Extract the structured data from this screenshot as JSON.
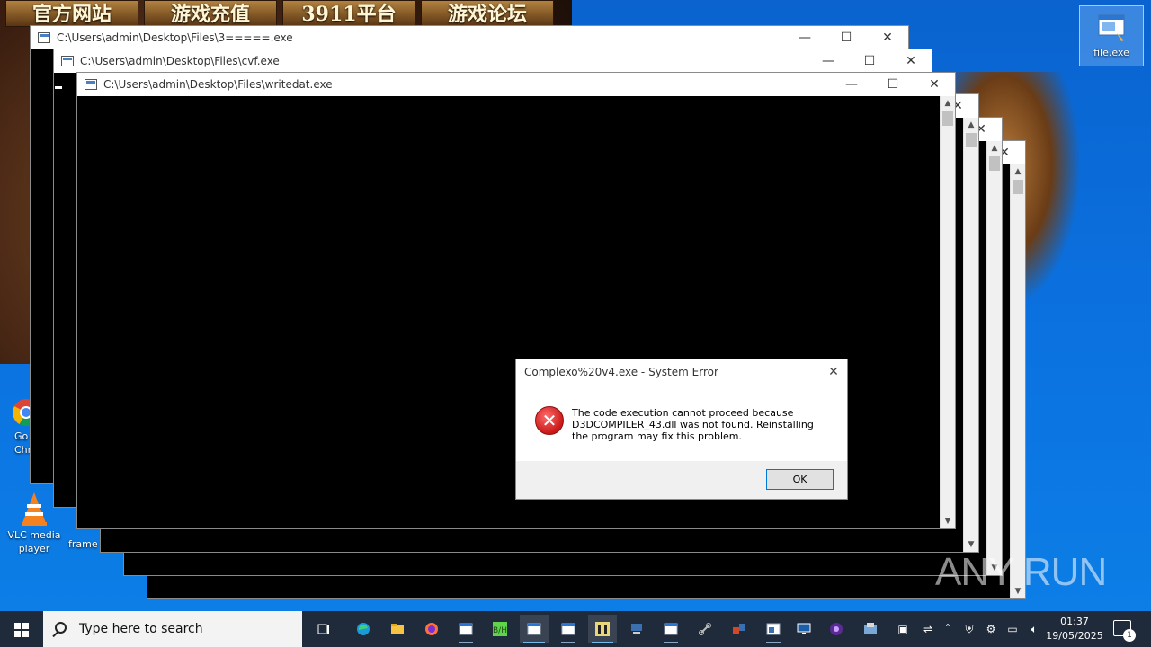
{
  "desktop": {
    "banner": [
      "官方网站",
      "游戏充值",
      "3911平台",
      "游戏论坛"
    ],
    "icons": [
      {
        "label": "file.exe"
      },
      {
        "label": "Go\nChr"
      },
      {
        "label": "VLC media player"
      },
      {
        "label": "frame"
      }
    ]
  },
  "windows": [
    {
      "title": "C:\\Users\\admin\\Desktop\\Files\\3=====.exe"
    },
    {
      "title": "C:\\Users\\admin\\Desktop\\Files\\cvf.exe"
    },
    {
      "title": "C:\\Users\\admin\\Desktop\\Files\\writedat.exe"
    }
  ],
  "window_controls": {
    "minimize": "—",
    "maximize": "☐",
    "close": "✕"
  },
  "dialog": {
    "title": "Complexo%20v4.exe - System Error",
    "message": "The code execution cannot proceed because D3DCOMPILER_43.dll was not found. Reinstalling the program may fix this problem.",
    "ok_label": "OK",
    "icon": "error-icon"
  },
  "watermark": "ANY RUN",
  "taskbar": {
    "search_placeholder": "Type here to search",
    "time": "01:37",
    "date": "19/05/2025",
    "notification_count": "1",
    "accent": "#76b9ed"
  }
}
